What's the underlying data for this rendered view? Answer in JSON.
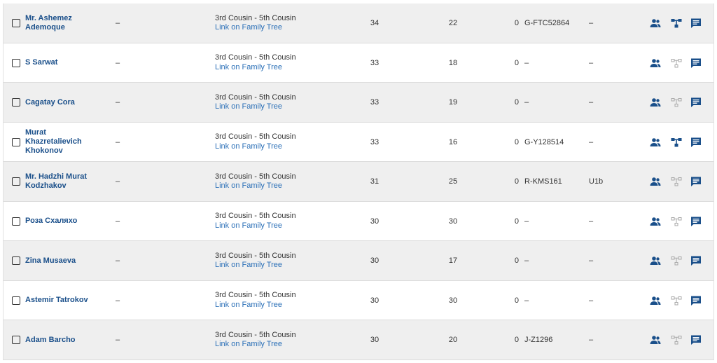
{
  "colors": {
    "link": "#2a6fb7",
    "name": "#1a4f8a",
    "icon": "#1a4f8a",
    "icon_disabled": "#aaaaaa",
    "row_alt": "#efefef"
  },
  "rows": [
    {
      "name": "Mr. Ashemez Ademoque",
      "dash": "–",
      "range": "3rd Cousin - 5th Cousin",
      "link": "Link on Family Tree",
      "shared": "34",
      "longest": "22",
      "x": "0",
      "ydna": "G-FTC52864",
      "mtdna": "–",
      "tree_active": true
    },
    {
      "name": "S Sarwat",
      "dash": "–",
      "range": "3rd Cousin - 5th Cousin",
      "link": "Link on Family Tree",
      "shared": "33",
      "longest": "18",
      "x": "0",
      "ydna": "–",
      "mtdna": "–",
      "tree_active": false
    },
    {
      "name": "Cagatay Cora",
      "dash": "–",
      "range": "3rd Cousin - 5th Cousin",
      "link": "Link on Family Tree",
      "shared": "33",
      "longest": "19",
      "x": "0",
      "ydna": "–",
      "mtdna": "–",
      "tree_active": false
    },
    {
      "name": "Murat Khazretalievich Khokonov",
      "dash": "–",
      "range": "3rd Cousin - 5th Cousin",
      "link": "Link on Family Tree",
      "shared": "33",
      "longest": "16",
      "x": "0",
      "ydna": "G-Y128514",
      "mtdna": "–",
      "tree_active": true
    },
    {
      "name": "Mr. Hadzhi Murat Kodzhakov",
      "dash": "–",
      "range": "3rd Cousin - 5th Cousin",
      "link": "Link on Family Tree",
      "shared": "31",
      "longest": "25",
      "x": "0",
      "ydna": "R-KMS161",
      "mtdna": "U1b",
      "tree_active": false
    },
    {
      "name": "Роза Схаляхо",
      "dash": "–",
      "range": "3rd Cousin - 5th Cousin",
      "link": "Link on Family Tree",
      "shared": "30",
      "longest": "30",
      "x": "0",
      "ydna": "–",
      "mtdna": "–",
      "tree_active": false
    },
    {
      "name": "Zina Musaeva",
      "dash": "–",
      "range": "3rd Cousin - 5th Cousin",
      "link": "Link on Family Tree",
      "shared": "30",
      "longest": "17",
      "x": "0",
      "ydna": "–",
      "mtdna": "–",
      "tree_active": false
    },
    {
      "name": "Astemir Tatrokov",
      "dash": "–",
      "range": "3rd Cousin - 5th Cousin",
      "link": "Link on Family Tree",
      "shared": "30",
      "longest": "30",
      "x": "0",
      "ydna": "–",
      "mtdna": "–",
      "tree_active": false
    },
    {
      "name": "Adam Barcho",
      "dash": "–",
      "range": "3rd Cousin - 5th Cousin",
      "link": "Link on Family Tree",
      "shared": "30",
      "longest": "20",
      "x": "0",
      "ydna": "J-Z1296",
      "mtdna": "–",
      "tree_active": false
    }
  ],
  "icons": {
    "profile": "people-icon",
    "tree": "family-tree-icon",
    "note": "note-icon"
  }
}
